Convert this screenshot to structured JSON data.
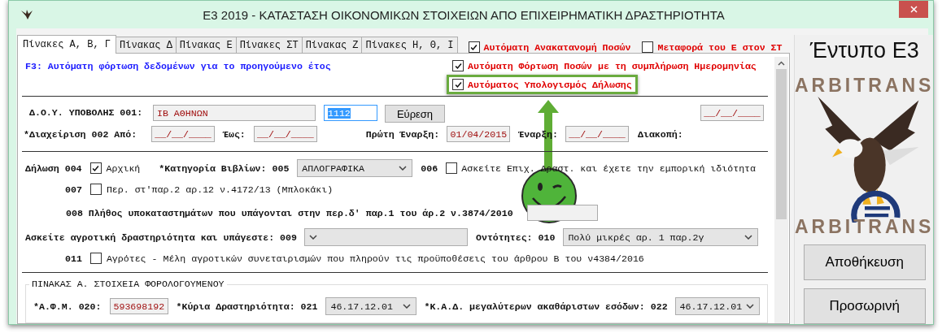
{
  "window": {
    "title": "Ε3 2019 - ΚΑΤΑΣΤΑΣΗ ΟΙΚΟΝΟΜΙΚΩΝ ΣΤΟΙΧΕΙΩΝ ΑΠΟ ΕΠΙΧΕΙΡΗΜΑΤΙΚΗ ΔΡΑΣΤΗΡΙΟΤΗΤΑ"
  },
  "tabs": [
    {
      "label": "Πίνακες Α, Β, Γ",
      "selected": true
    },
    {
      "label": "Πίνακας Δ",
      "selected": false
    },
    {
      "label": "Πίνακας Ε",
      "selected": false
    },
    {
      "label": "Πίνακες ΣΤ",
      "selected": false
    },
    {
      "label": "Πίνακας Ζ",
      "selected": false
    },
    {
      "label": "Πίνακες Η, Θ, Ι",
      "selected": false
    }
  ],
  "tab_options": [
    {
      "label": "Αυτόματη Ανακατανομή Ποσών",
      "checked": true
    },
    {
      "label": "Μεταφορά του Ε στον ΣΤ",
      "checked": false
    }
  ],
  "hint": "F3: Αυτόματη φόρτωση δεδομένων για το προηγούμενο έτος",
  "auto_options": [
    {
      "label": "Αυτόματη Φόρτωση Ποσών με τη συμπλήρωση Ημερομηνίας",
      "checked": true,
      "highlighted": false
    },
    {
      "label": "Αυτόματος Υπολογισμός Δήλωσης",
      "checked": true,
      "highlighted": true
    }
  ],
  "submission": {
    "label": "Δ.Ο.Υ. ΥΠΟΒΟΛΗΣ 001:",
    "office": "ΙΒ ΑΘΗΝΩΝ",
    "code": "1112",
    "code_selected": true,
    "find_button": "Εύρεση",
    "extra_date": "__/__/____"
  },
  "management": {
    "label": "*Διαχείριση  002 Από:",
    "from": "__/__/____",
    "to_label": "Έως:",
    "to": "__/__/____",
    "first_start_label": "Πρώτη Έναρξη:",
    "first_start": "01/04/2015",
    "start_label": "Έναρξη:",
    "start": "__/__/____",
    "stop_label": "Διακοπή:"
  },
  "declaration": {
    "label": "Δήλωση 004",
    "initial": {
      "label": "Αρχική",
      "checked": true
    },
    "books_label": "*Κατηγορία Βιβλίων: 005",
    "books": "ΑΠΛΟΓΡΑΦΙΚΑ",
    "code_006": "006",
    "commercial": {
      "label": "Ασκείτε Επιχ. Δραστ. και έχετε την εμπορική ιδιότητα",
      "checked": false
    }
  },
  "field_007": {
    "code": "007",
    "label": "Περ. στ'παρ.2 αρ.12 ν.4172/13 (Μπλοκάκι)",
    "checked": false
  },
  "field_008": {
    "label": "008 Πλήθος υποκαταστημάτων που υπάγονται στην περ.δ' παρ.1 του άρ.2 ν.3874/2010"
  },
  "agriculture": {
    "label": "Ασκείτε αγροτική δραστηριότητα και υπάγεστε: 009",
    "entities_label": "Οντότητες: 010",
    "entities": "Πολύ μικρές αρ. 1 παρ.2γ"
  },
  "field_011": {
    "code": "011",
    "label": "Αγρότες - Μέλη αγροτικών συνεταιρισμών που πληρούν τις προϋποθέσεις του άρθρου Β του ν4384/2016",
    "checked": false
  },
  "table_a": {
    "title": "ΠΙΝΑΚΑΣ Α. ΣΤΟΙΧΕΙΑ ΦΟΡΟΛΟΓΟΥΜΕΝΟΥ",
    "afm_label": "*Α.Φ.Μ. 020:",
    "afm": "593698192",
    "activity_label": "*Κύρια Δραστηριότητα: 021",
    "activity": "46.17.12.01",
    "kad_label": "*Κ.Α.Δ. μεγαλύτερων ακαθάριστων εσόδων: 022",
    "kad": "46.17.12.01"
  },
  "side": {
    "form_title": "Έντυπο Ε3",
    "logo_top": "ARBITRANS",
    "logo_bottom": "ARBITRANS",
    "buttons": [
      "Αποθήκευση",
      "Προσωρινή"
    ]
  }
}
